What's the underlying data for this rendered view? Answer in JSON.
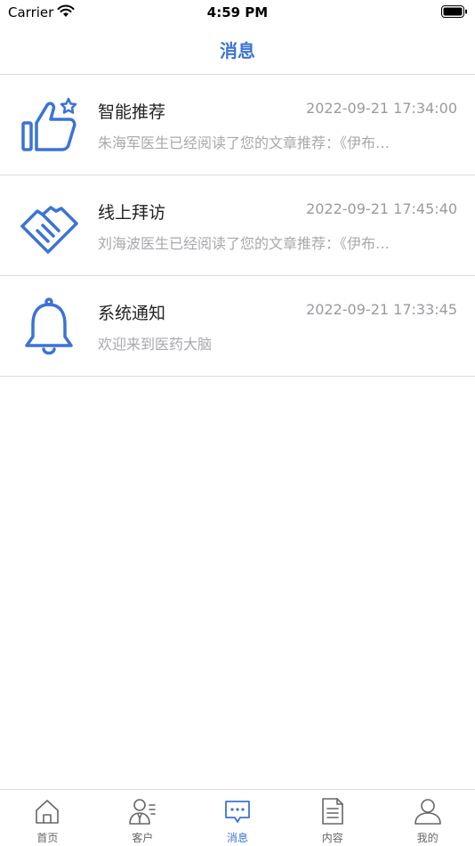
{
  "status_bar": {
    "carrier": "Carrier",
    "time": "4:59 PM"
  },
  "nav": {
    "title": "消息"
  },
  "messages": [
    {
      "title": "智能推荐",
      "time": "2022-09-21 17:34:00",
      "preview": "朱海军医生已经阅读了您的文章推荐：《伊布…",
      "icon": "thumbs-up-star-icon"
    },
    {
      "title": "线上拜访",
      "time": "2022-09-21 17:45:40",
      "preview": "刘海波医生已经阅读了您的文章推荐：《伊布…",
      "icon": "handshake-icon"
    },
    {
      "title": "系统通知",
      "time": "2022-09-21 17:33:45",
      "preview": "欢迎来到医药大脑",
      "icon": "bell-icon"
    }
  ],
  "tabs": [
    {
      "label": "首页",
      "icon": "home-icon",
      "active": false
    },
    {
      "label": "客户",
      "icon": "customer-icon",
      "active": false
    },
    {
      "label": "消息",
      "icon": "message-icon",
      "active": true
    },
    {
      "label": "内容",
      "icon": "document-icon",
      "active": false
    },
    {
      "label": "我的",
      "icon": "profile-icon",
      "active": false
    }
  ],
  "colors": {
    "accent": "#3b73d6",
    "divider": "#dcdcdc",
    "muted_text": "#a8a8ae",
    "tab_inactive": "#666666"
  }
}
